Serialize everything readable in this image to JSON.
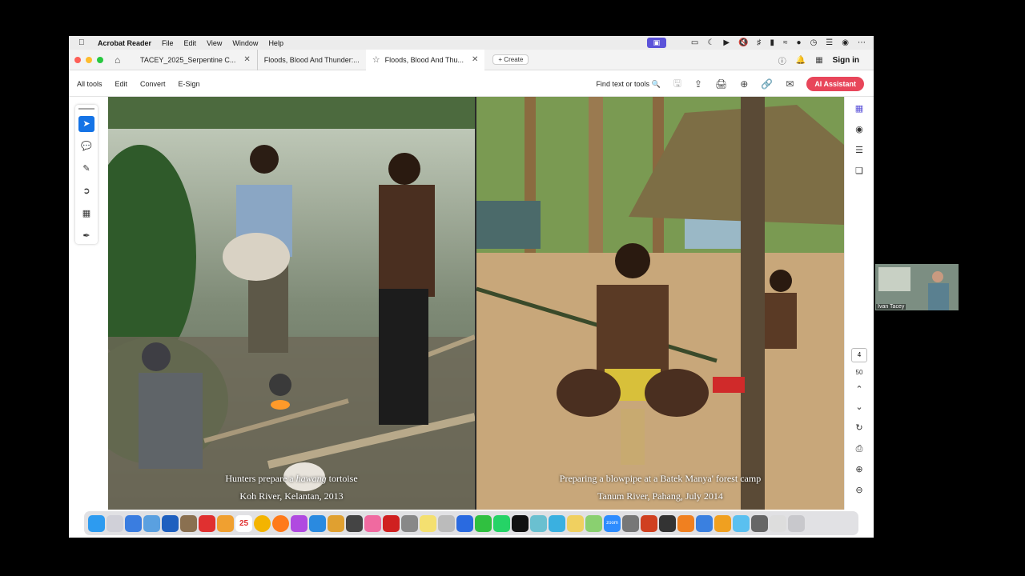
{
  "menubar": {
    "app_name": "Acrobat Reader",
    "menus": [
      "File",
      "Edit",
      "View",
      "Window",
      "Help"
    ]
  },
  "tabs": [
    {
      "label": "TACEY_2025_Serpentine C..."
    },
    {
      "label": "Floods, Blood And Thunder:..."
    },
    {
      "label": "Floods, Blood And Thu..."
    }
  ],
  "tabbar": {
    "create_label": "Create",
    "signin_label": "Sign in"
  },
  "toolbar": {
    "items": [
      "All tools",
      "Edit",
      "Convert",
      "E-Sign"
    ],
    "find_label": "Find text or tools",
    "ai_label": "AI Assistant"
  },
  "captions": {
    "left_line1_pre": "Hunters prepare a ",
    "left_line1_italic": "hawang",
    "left_line1_post": " tortoise",
    "left_line2": "Koh River, Kelantan, 2013",
    "right_line1": "Preparing a blowpipe at a Batek Manya' forest camp",
    "right_line2": "Tanum River, Pahang, July 2014"
  },
  "pagination": {
    "current": "4",
    "total": "50"
  },
  "dock": {
    "calendar_date": "25",
    "zoom_label": "zoom"
  },
  "participant": {
    "name": "Ivan Tacey"
  },
  "colors": {
    "accent": "#1473e6",
    "ai_button": "#e8465a",
    "zoom_purple": "#5b52d9"
  }
}
